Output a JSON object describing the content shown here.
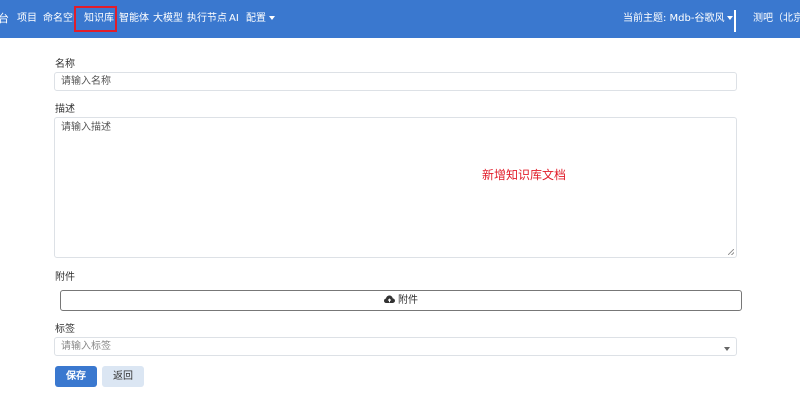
{
  "navbar": {
    "brand_fragment": "台",
    "items": [
      {
        "label": "项目"
      },
      {
        "label": "命名空间"
      },
      {
        "label": "知识库"
      },
      {
        "label": "智能体"
      },
      {
        "label": "大模型"
      },
      {
        "label": "执行节点"
      },
      {
        "label": "AI"
      },
      {
        "label": "配置"
      }
    ],
    "theme_label": "当前主题: Mdb-谷歌风",
    "user_label": "测吧（北京）"
  },
  "form": {
    "name_label": "名称",
    "name_placeholder": "请输入名称",
    "description_label": "描述",
    "description_placeholder": "请输入描述",
    "attachment_label": "附件",
    "attachment_button_label": "附件",
    "tags_label": "标签",
    "tags_placeholder": "请输入标签",
    "save_label": "保存",
    "back_label": "返回"
  },
  "annotation": {
    "text": "新增知识库文档",
    "color": "#e11d2a"
  },
  "colors": {
    "navbar_bg": "#3a78cf",
    "primary_button": "#3a78cf",
    "secondary_button": "#dbe6f3",
    "highlight": "#e11d2a"
  },
  "icons": {
    "attachment": "cloud-upload-icon",
    "nav_dropdown": "caret-down-icon",
    "tags_dropdown": "caret-down-icon"
  }
}
